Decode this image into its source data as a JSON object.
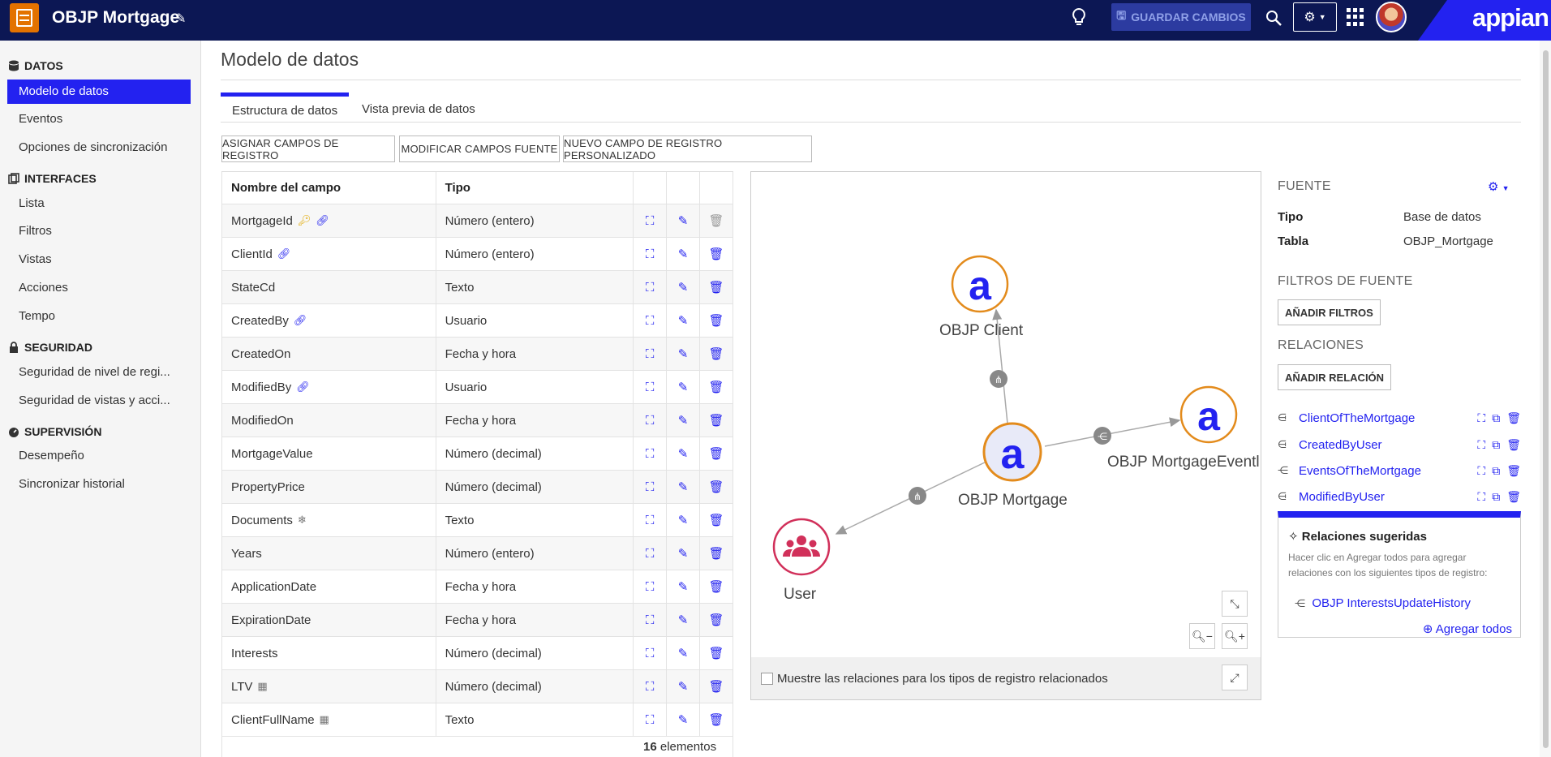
{
  "header": {
    "app_title": "OBJP Mortgage",
    "save_label": "GUARDAR CAMBIOS",
    "brand": "appian",
    "colors": {
      "bar": "#0c1754",
      "accent": "#2322f0",
      "app_icon": "#e37200"
    }
  },
  "sidebar": {
    "sections": [
      {
        "title": "DATOS",
        "icon": "database-icon",
        "items": [
          "Modelo de datos",
          "Eventos",
          "Opciones de sincronización"
        ]
      },
      {
        "title": "INTERFACES",
        "icon": "interfaces-icon",
        "items": [
          "Lista",
          "Filtros",
          "Vistas",
          "Acciones",
          "Tempo"
        ]
      },
      {
        "title": "SEGURIDAD",
        "icon": "lock-icon",
        "items": [
          "Seguridad de nivel de regi...",
          "Seguridad de vistas y acci..."
        ]
      },
      {
        "title": "SUPERVISIÓN",
        "icon": "monitoring-icon",
        "items": [
          "Desempeño",
          "Sincronizar historial"
        ]
      }
    ],
    "active_item": "Modelo de datos"
  },
  "main": {
    "title": "Modelo de datos",
    "tabs": [
      "Estructura de datos",
      "Vista previa de datos"
    ],
    "active_tab": "Estructura de datos",
    "buttons": [
      "ASIGNAR CAMPOS DE REGISTRO",
      "MODIFICAR CAMPOS FUENTE",
      "NUEVO CAMPO DE REGISTRO PERSONALIZADO"
    ]
  },
  "table": {
    "headers": [
      "Nombre del campo",
      "Tipo"
    ],
    "rows": [
      {
        "name": "MortgageId",
        "type": "Número (entero)",
        "icons": [
          "key-icon",
          "link-icon"
        ]
      },
      {
        "name": "ClientId",
        "type": "Número (entero)",
        "icons": [
          "link-icon"
        ]
      },
      {
        "name": "StateCd",
        "type": "Texto",
        "icons": []
      },
      {
        "name": "CreatedBy",
        "type": "Usuario",
        "icons": [
          "link-icon"
        ]
      },
      {
        "name": "CreatedOn",
        "type": "Fecha y hora",
        "icons": []
      },
      {
        "name": "ModifiedBy",
        "type": "Usuario",
        "icons": [
          "link-icon"
        ]
      },
      {
        "name": "ModifiedOn",
        "type": "Fecha y hora",
        "icons": []
      },
      {
        "name": "MortgageValue",
        "type": "Número (decimal)",
        "icons": []
      },
      {
        "name": "PropertyPrice",
        "type": "Número (decimal)",
        "icons": []
      },
      {
        "name": "Documents",
        "type": "Texto",
        "icons": [
          "snowflake-icon"
        ]
      },
      {
        "name": "Years",
        "type": "Número (entero)",
        "icons": []
      },
      {
        "name": "ApplicationDate",
        "type": "Fecha y hora",
        "icons": []
      },
      {
        "name": "ExpirationDate",
        "type": "Fecha y hora",
        "icons": []
      },
      {
        "name": "Interests",
        "type": "Número (decimal)",
        "icons": []
      },
      {
        "name": "LTV",
        "type": "Número (decimal)",
        "icons": [
          "calculator-icon"
        ]
      },
      {
        "name": "ClientFullName",
        "type": "Texto",
        "icons": [
          "calculator-icon"
        ]
      }
    ],
    "count_number": "16",
    "count_label": "elementos"
  },
  "diagram": {
    "nodes": {
      "client": "OBJP Client",
      "mortgage": "OBJP Mortgage",
      "event": "OBJP MortgageEventl",
      "user": "User"
    },
    "checkbox_label": "Muestre las relaciones para los tipos de registro relacionados",
    "checkbox_checked": false
  },
  "source_panel": {
    "source_heading": "FUENTE",
    "type_key": "Tipo",
    "type_value": "Base de datos",
    "table_key": "Tabla",
    "table_value": "OBJP_Mortgage",
    "filters_heading": "FILTROS DE FUENTE",
    "add_filters": "AÑADIR FILTROS",
    "relations_heading": "RELACIONES",
    "add_relation": "AÑADIR RELACIÓN",
    "relations": [
      {
        "name": "ClientOfTheMortgage",
        "icon": "many-to-one-icon"
      },
      {
        "name": "CreatedByUser",
        "icon": "many-to-one-icon"
      },
      {
        "name": "EventsOfTheMortgage",
        "icon": "one-to-many-icon"
      },
      {
        "name": "ModifiedByUser",
        "icon": "many-to-one-icon"
      }
    ],
    "suggested": {
      "title": "Relaciones sugeridas",
      "description": "Hacer clic en Agregar todos para agregar relaciones con los siguientes tipos de registro:",
      "item": "OBJP InterestsUpdateHistory",
      "add_all": "Agregar todos"
    }
  }
}
